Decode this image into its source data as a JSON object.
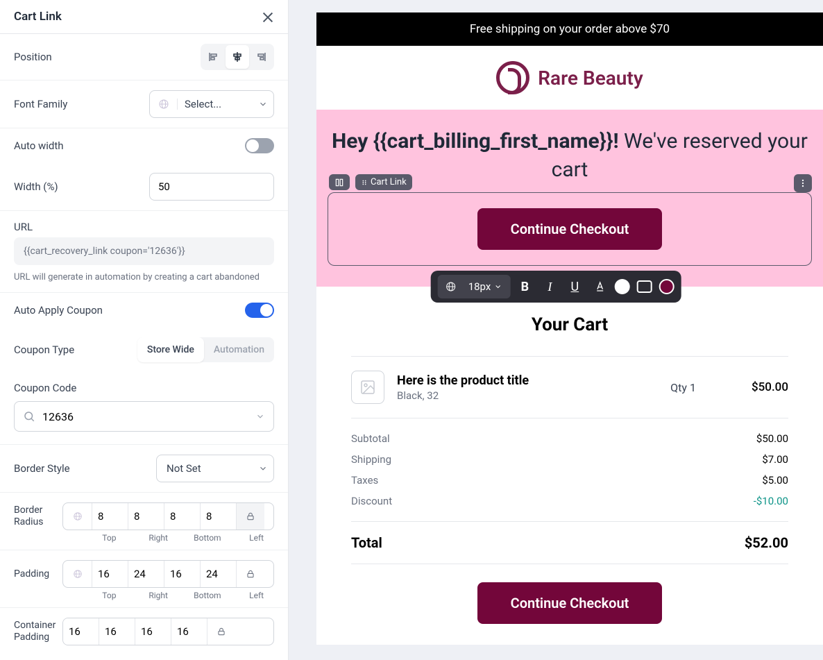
{
  "panel": {
    "title": "Cart Link",
    "position_label": "Position",
    "font_family_label": "Font Family",
    "font_family_value": "Select...",
    "auto_width_label": "Auto width",
    "auto_width_on": false,
    "width_label": "Width (%)",
    "width_value": "50",
    "url_label": "URL",
    "url_value": "{{cart_recovery_link coupon='12636'}}",
    "url_hint": "URL will generate in automation by creating a cart abandoned",
    "auto_apply_label": "Auto Apply Coupon",
    "auto_apply_on": true,
    "coupon_type_label": "Coupon Type",
    "coupon_type_options": [
      "Store Wide",
      "Automation"
    ],
    "coupon_code_label": "Coupon Code",
    "coupon_code_value": "12636",
    "border_style_label": "Border Style",
    "border_style_value": "Not Set",
    "border_radius_label": "Border Radius",
    "border_radius": {
      "top": "8",
      "right": "8",
      "bottom": "8",
      "left": "8"
    },
    "padding_label": "Padding",
    "padding": {
      "top": "16",
      "right": "24",
      "bottom": "16",
      "left": "24"
    },
    "container_padding_label": "Container Padding",
    "container_padding": {
      "top": "16",
      "right": "16",
      "bottom": "16",
      "left": "16"
    },
    "edge_labels": [
      "Top",
      "Right",
      "Bottom",
      "Left"
    ]
  },
  "preview": {
    "banner": "Free shipping on your order above $70",
    "brand": "Rare Beauty",
    "hero_bold": "Hey {{cart_billing_first_name}}!",
    "hero_rest": " We've reserved your cart",
    "chip_label": "Cart Link",
    "cta": "Continue Checkout",
    "toolbar_size": "18px",
    "cart_heading": "Your Cart",
    "product": {
      "title": "Here is the product title",
      "variant": "Black, 32",
      "qty": "Qty 1",
      "price": "$50.00"
    },
    "totals": {
      "subtotal_l": "Subtotal",
      "subtotal_v": "$50.00",
      "shipping_l": "Shipping",
      "shipping_v": "$7.00",
      "taxes_l": "Taxes",
      "taxes_v": "$5.00",
      "discount_l": "Discount",
      "discount_v": "-$10.00",
      "total_l": "Total",
      "total_v": "$52.00"
    },
    "cta2": "Continue Checkout"
  },
  "colors": {
    "accent": "#73063a",
    "hero_bg": "#ffc3de",
    "discount": "#0d9488"
  }
}
